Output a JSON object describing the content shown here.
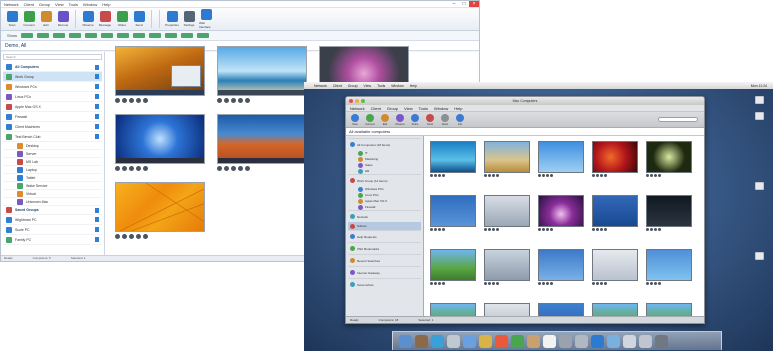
{
  "win": {
    "menu": [
      "Network",
      "Client",
      "Group",
      "View",
      "Tools",
      "Window",
      "Help"
    ],
    "toolbar": [
      "Scan",
      "Connect",
      "Edit",
      "Remote",
      "Observe",
      "Message",
      "Share",
      "Send",
      "",
      "Properties",
      "Settings",
      "Web Interface"
    ],
    "filter_label": "Show",
    "header": "Demo, All",
    "side_search": "Search",
    "side_items": [
      {
        "label": "All Computers",
        "kind": "hdr"
      },
      {
        "label": "Work Group",
        "kind": "sel"
      },
      {
        "label": "Windows PCs",
        "kind": "item"
      },
      {
        "label": "Linux PCs",
        "kind": "item"
      },
      {
        "label": "Apple Mac OS X",
        "kind": "item"
      },
      {
        "label": "Firewall",
        "kind": "item"
      },
      {
        "label": "Client Machines",
        "kind": "item"
      },
      {
        "label": "Test Bench Club",
        "kind": "item"
      },
      {
        "label": "Desktop",
        "kind": "sub"
      },
      {
        "label": "Server",
        "kind": "sub"
      },
      {
        "label": "MS Lab",
        "kind": "sub"
      },
      {
        "label": "Laptop",
        "kind": "sub"
      },
      {
        "label": "Tablet",
        "kind": "sub"
      },
      {
        "label": "Wake Service",
        "kind": "sub"
      },
      {
        "label": "Virtual",
        "kind": "sub"
      },
      {
        "label": "Unknown Mac",
        "kind": "sub"
      },
      {
        "label": "Saved Groups",
        "kind": "hdr"
      },
      {
        "label": "Wightman PC",
        "kind": "item"
      },
      {
        "label": "Suzie PC",
        "kind": "item"
      },
      {
        "label": "Family PC",
        "kind": "item"
      }
    ],
    "status": [
      "Ready",
      "Computers: 5",
      "Selected: 1"
    ]
  },
  "mac": {
    "menubar": [
      "Network",
      "Client",
      "Group",
      "View",
      "Tools",
      "Window",
      "Help"
    ],
    "clock": "Mon 11:24",
    "title": "Mac Computers",
    "menu": [
      "Network",
      "Client",
      "Group",
      "View",
      "Tools",
      "Window",
      "Help"
    ],
    "toolbar": [
      "Scan",
      "Connect",
      "Edit",
      "Observe",
      "Share",
      "Send",
      "Notes",
      "Info"
    ],
    "header": "All available computers",
    "side_items": [
      {
        "label": "All Computers (18 Items)",
        "kind": "group"
      },
      {
        "label": "IT",
        "kind": "sub"
      },
      {
        "label": "Marketing",
        "kind": "sub"
      },
      {
        "label": "Sales",
        "kind": "sub"
      },
      {
        "label": "HR",
        "kind": "sub"
      },
      {
        "label": "Work Group (12 Items)",
        "kind": "group"
      },
      {
        "label": "Windows PCs",
        "kind": "sub"
      },
      {
        "label": "Linux PCs",
        "kind": "sub"
      },
      {
        "label": "Apple Mac OS X",
        "kind": "sub"
      },
      {
        "label": "Firewall",
        "kind": "sub"
      },
      {
        "label": "Network",
        "kind": "group"
      },
      {
        "label": "Subnet",
        "kind": "sel"
      },
      {
        "label": "Help Requests",
        "kind": "group"
      },
      {
        "label": "VNC Bookmarks",
        "kind": "group"
      },
      {
        "label": "Recent Searches",
        "kind": "group"
      },
      {
        "label": "Internet Gateway",
        "kind": "group"
      },
      {
        "label": "Screenshots",
        "kind": "group"
      }
    ],
    "status": [
      "Ready",
      "Computers: 18",
      "Selected: 1"
    ]
  },
  "colors": {
    "win_accent": "#2f7fd3",
    "win_filter": "#4aa56b",
    "mac_selection": "#b6c9e0"
  }
}
